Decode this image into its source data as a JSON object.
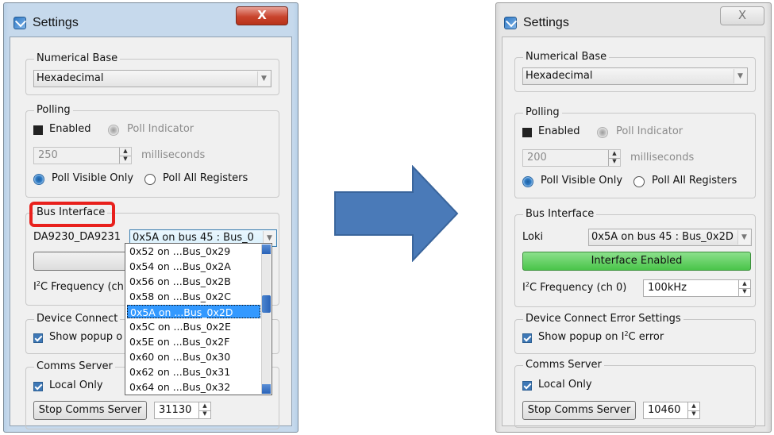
{
  "before": {
    "window_title": "Settings",
    "close_label": "X",
    "numerical_base": {
      "group_label": "Numerical Base",
      "value": "Hexadecimal"
    },
    "polling": {
      "group_label": "Polling",
      "enabled_label": "Enabled",
      "poll_indicator_label": "Poll Indicator",
      "interval_value": "250",
      "interval_unit": "milliseconds",
      "poll_visible_label": "Poll Visible Only",
      "poll_all_label": "Poll All Registers"
    },
    "bus_interface": {
      "group_label": "Bus Interface",
      "device_label": "DA9230_DA9231",
      "bus_value": "0x5A on bus 45 : Bus_0",
      "interface_button_label": "Inter",
      "i2c_freq_prefix": "I",
      "i2c_freq_sup": "2",
      "i2c_freq_suffix": "C Frequency (ch"
    },
    "dropdown_items": [
      "0x52 on ...Bus_0x29",
      "0x54 on ...Bus_0x2A",
      "0x56 on ...Bus_0x2B",
      "0x58 on ...Bus_0x2C",
      "0x5A on ...Bus_0x2D",
      "0x5C on ...Bus_0x2E",
      "0x5E on ...Bus_0x2F",
      "0x60 on ...Bus_0x30",
      "0x62 on ...Bus_0x31",
      "0x64 on ...Bus_0x32"
    ],
    "dropdown_selected_index": 4,
    "device_connect": {
      "group_label": "Device Connect",
      "popup_label": "Show popup o"
    },
    "comms_server": {
      "group_label": "Comms Server",
      "local_only_label": "Local Only",
      "stop_button_label": "Stop Comms Server",
      "port_value": "31130"
    }
  },
  "after": {
    "window_title": "Settings",
    "close_label": "X",
    "numerical_base": {
      "group_label": "Numerical Base",
      "value": "Hexadecimal"
    },
    "polling": {
      "group_label": "Polling",
      "enabled_label": "Enabled",
      "poll_indicator_label": "Poll Indicator",
      "interval_value": "200",
      "interval_unit": "milliseconds",
      "poll_visible_label": "Poll Visible Only",
      "poll_all_label": "Poll All Registers"
    },
    "bus_interface": {
      "group_label": "Bus Interface",
      "device_label": "Loki",
      "bus_value": "0x5A on bus 45 : Bus_0x2D",
      "interface_button_label": "Interface Enabled",
      "i2c_freq_prefix": "I",
      "i2c_freq_sup": "2",
      "i2c_freq_suffix": "C Frequency (ch 0)",
      "i2c_freq_value": "100kHz"
    },
    "device_connect": {
      "group_label": "Device Connect Error Settings",
      "popup_prefix": "Show popup on I",
      "popup_sup": "2",
      "popup_suffix": "C error"
    },
    "comms_server": {
      "group_label": "Comms Server",
      "local_only_label": "Local Only",
      "stop_button_label": "Stop Comms Server",
      "port_value": "10460"
    }
  },
  "colors": {
    "arrow": "#4a7ab8",
    "highlight_box": "#e8201c",
    "interface_enabled": "#55c955",
    "selection": "#3399ff"
  }
}
